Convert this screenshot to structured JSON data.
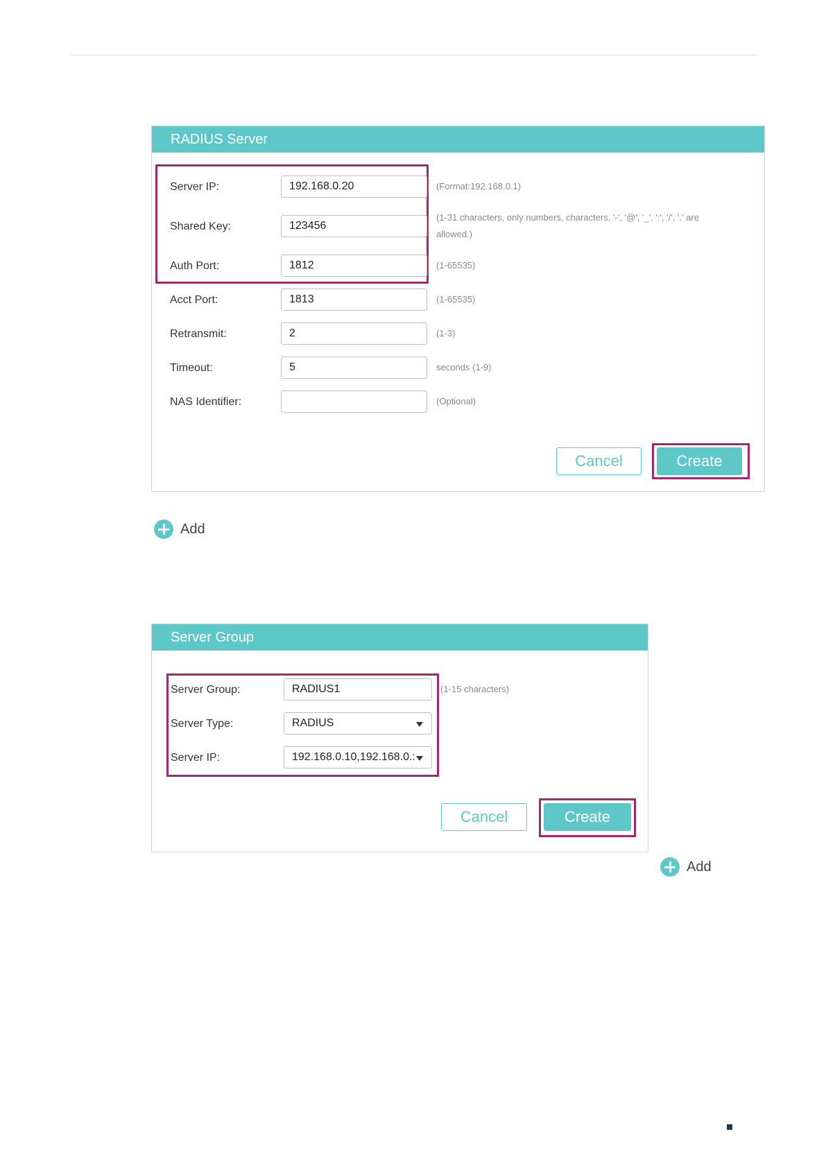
{
  "radius_server": {
    "title": "RADIUS Server",
    "fields": {
      "server_ip": {
        "label": "Server IP:",
        "value": "192.168.0.20",
        "hint": "(Format:192.168.0.1)"
      },
      "shared_key": {
        "label": "Shared Key:",
        "value": "123456",
        "hint_line1": "(1-31 characters, only numbers, characters, '-', '@', '_', ':', '/', '.' are",
        "hint_line2": "allowed.)"
      },
      "auth_port": {
        "label": "Auth Port:",
        "value": "1812",
        "hint": "(1-65535)"
      },
      "acct_port": {
        "label": "Acct Port:",
        "value": "1813",
        "hint": "(1-65535)"
      },
      "retransmit": {
        "label": "Retransmit:",
        "value": "2",
        "hint": "(1-3)"
      },
      "timeout": {
        "label": "Timeout:",
        "value": "5",
        "hint": "seconds (1-9)"
      },
      "nas_identifier": {
        "label": "NAS Identifier:",
        "value": "",
        "hint": "(Optional)"
      }
    },
    "cancel_label": "Cancel",
    "create_label": "Create"
  },
  "add_link_1": {
    "label": "Add"
  },
  "server_group": {
    "title": "Server Group",
    "fields": {
      "group_name": {
        "label": "Server Group:",
        "value": "RADIUS1",
        "hint": "(1-15 characters)"
      },
      "server_type": {
        "label": "Server Type:",
        "value": "RADIUS"
      },
      "server_ip": {
        "label": "Server IP:",
        "value": "192.168.0.10,192.168.0.:"
      }
    },
    "cancel_label": "Cancel",
    "create_label": "Create"
  },
  "add_link_2": {
    "label": "Add"
  },
  "colors": {
    "accent": "#5ec8c8",
    "highlight": "#a3286f"
  },
  "icons": {
    "add": "plus-circle-icon",
    "dropdown": "caret-down-icon"
  }
}
